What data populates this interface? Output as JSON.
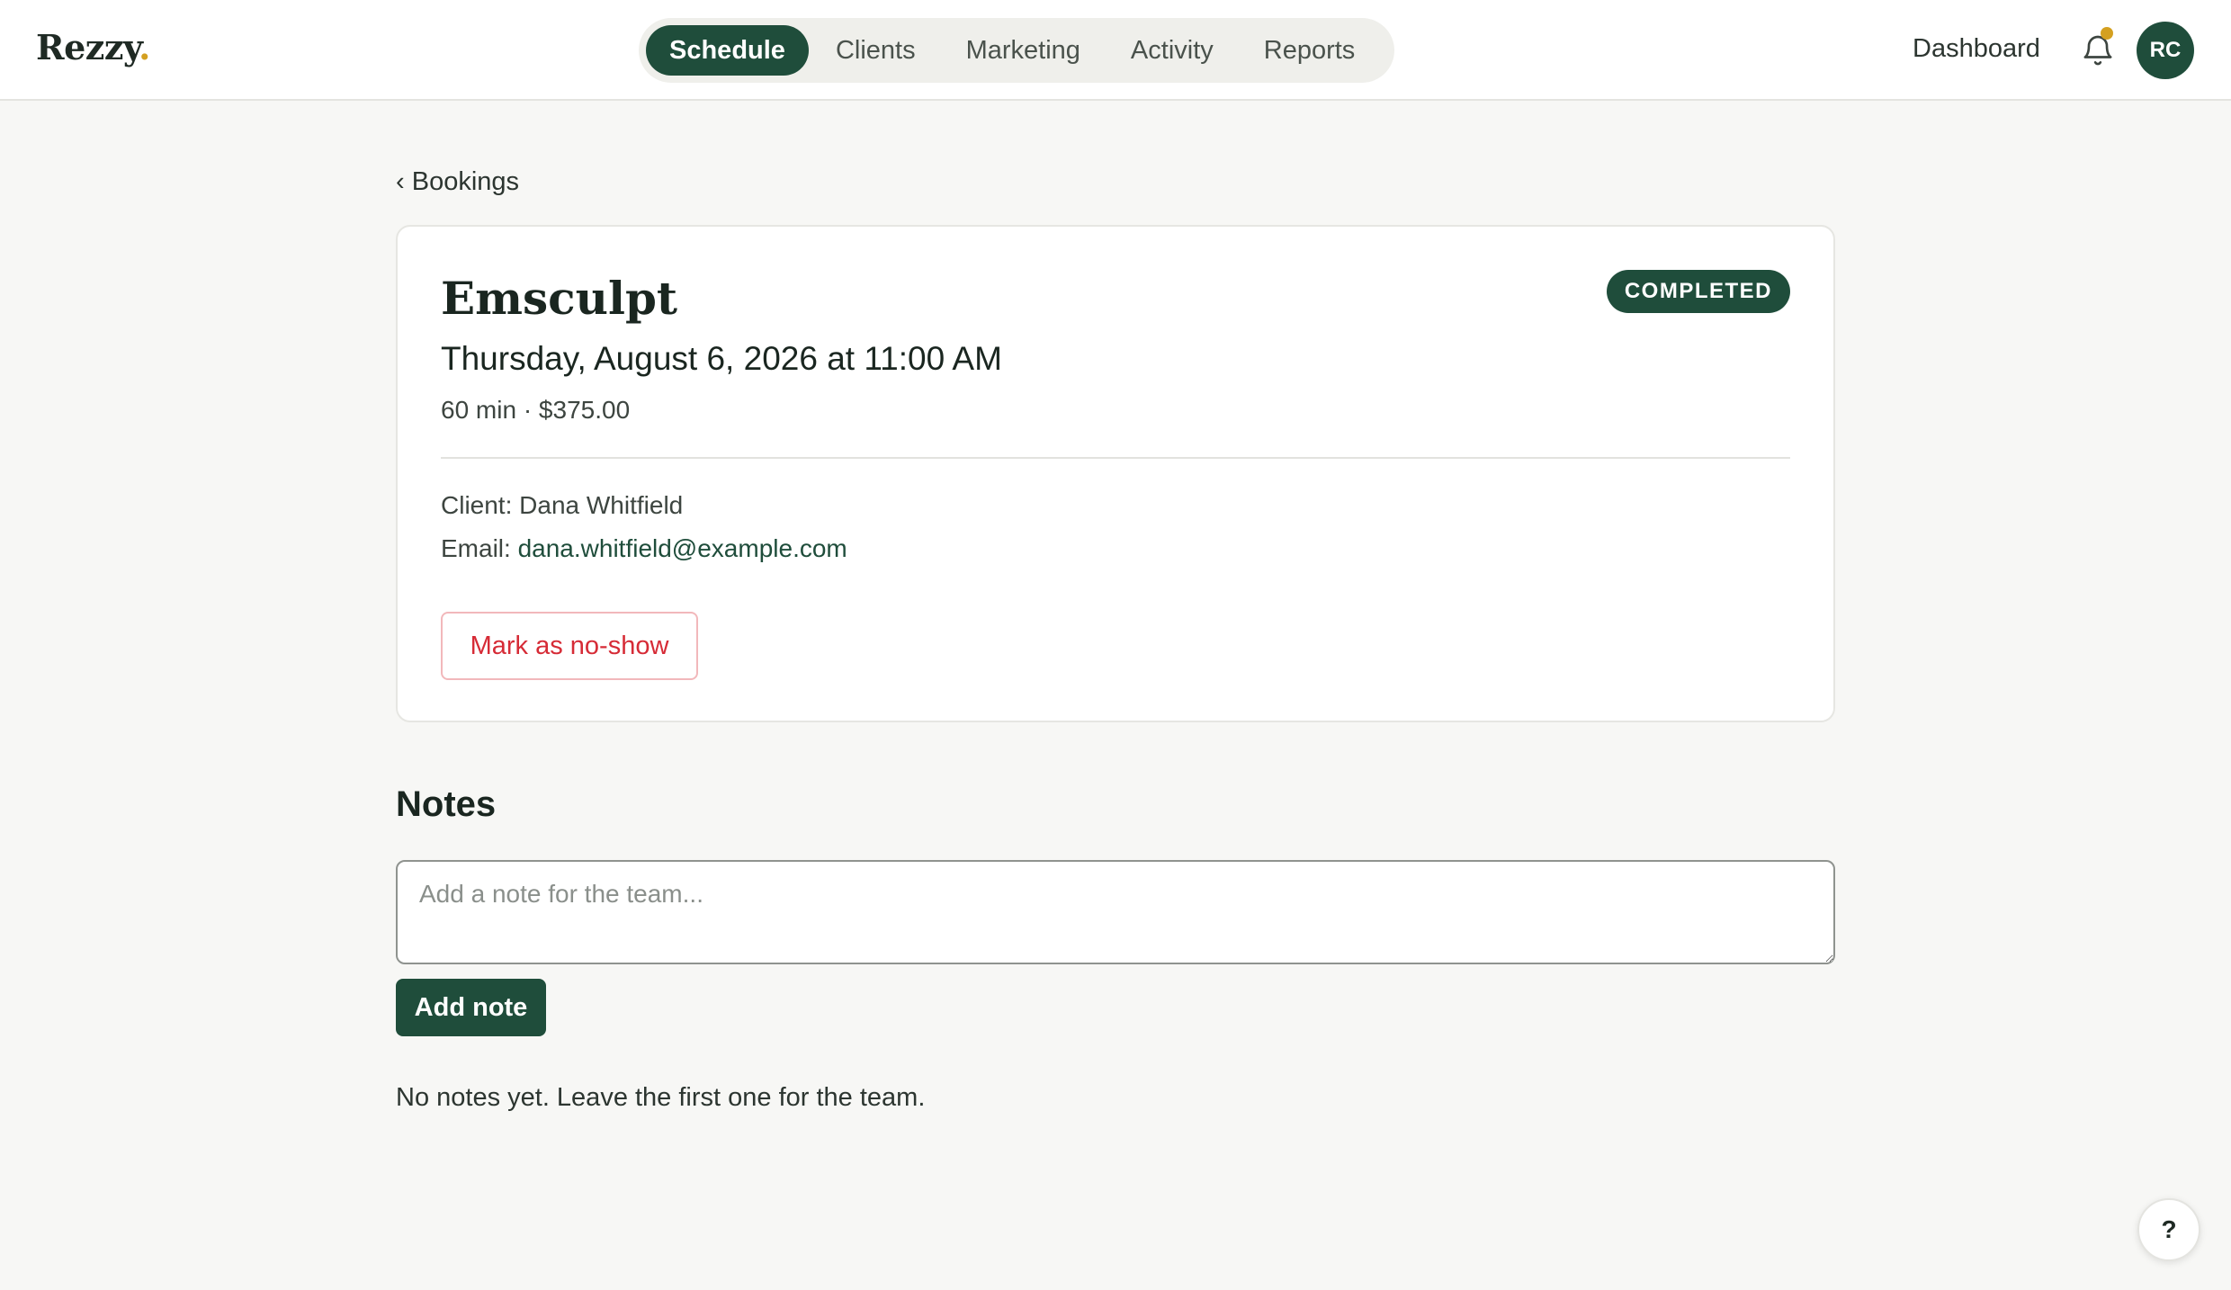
{
  "app": {
    "logo_text": "Rezzy",
    "logo_dot": "."
  },
  "nav": {
    "tabs": [
      {
        "label": "Schedule",
        "active": true
      },
      {
        "label": "Clients",
        "active": false
      },
      {
        "label": "Marketing",
        "active": false
      },
      {
        "label": "Activity",
        "active": false
      },
      {
        "label": "Reports",
        "active": false
      }
    ]
  },
  "header": {
    "dashboard_label": "Dashboard",
    "notification_icon": "bell-icon",
    "has_notification": true,
    "avatar_initials": "RC"
  },
  "breadcrumb": {
    "chevron": "‹",
    "label": "Bookings"
  },
  "booking": {
    "service": "Emsculpt",
    "status": "COMPLETED",
    "datetime": "Thursday, August 6, 2026 at 11:00 AM",
    "meta": "60 min · $375.00",
    "client_label": "Client:",
    "client_name": "Dana Whitfield",
    "email_label": "Email:",
    "email": "dana.whitfield@example.com",
    "noshow_label": "Mark as no-show"
  },
  "notes": {
    "heading": "Notes",
    "placeholder": "Add a note for the team...",
    "add_label": "Add note",
    "empty_text": "No notes yet. Leave the first one for the team."
  },
  "help": {
    "label": "?"
  },
  "colors": {
    "brand": "#1f4d3b",
    "accent": "#d4a020",
    "danger": "#d62b36",
    "background": "#f7f7f5"
  }
}
